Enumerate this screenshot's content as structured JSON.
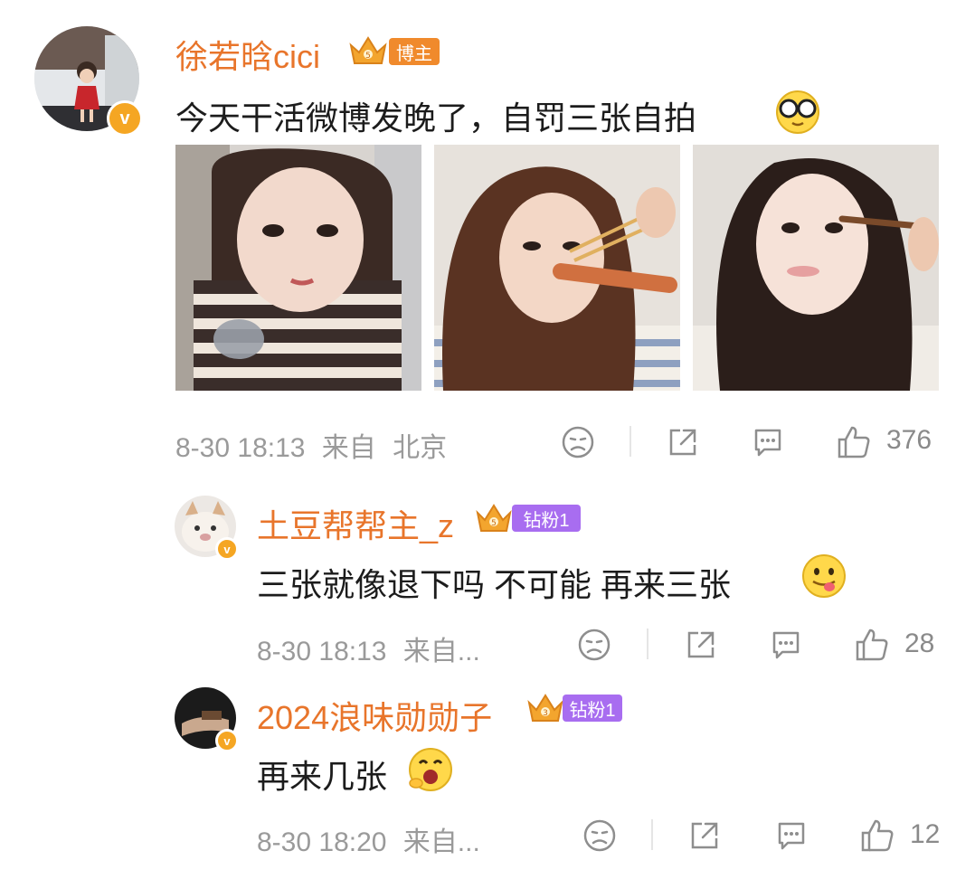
{
  "post": {
    "author": "徐若晗cici",
    "badge": "博主",
    "content": "今天干活微博发晚了，自罚三张自拍",
    "time": "8-30 18:13",
    "source_prefix": "来自",
    "location": "北京",
    "like_count": "376",
    "photos": [
      "selfie-striped-sweater",
      "selfie-chopsticks-sausage",
      "selfie-makeup-brush"
    ]
  },
  "comments": [
    {
      "author": "土豆帮帮主_z",
      "badge": "钻粉1",
      "text": "三张就像退下吗 不可能 再来三张",
      "time": "8-30 18:13",
      "source": "来自...",
      "like_count": "28"
    },
    {
      "author": "2024浪味勋勋子",
      "badge": "钻粉1",
      "text": "再来几张",
      "time": "8-30 18:20",
      "source": "来自...",
      "like_count": "12"
    }
  ],
  "colors": {
    "username": "#e8752b",
    "blogger_tag": "#f08a2c",
    "fan_tag": "#a86df0",
    "verified": "#f5a623",
    "meta": "#9a9a9a"
  }
}
